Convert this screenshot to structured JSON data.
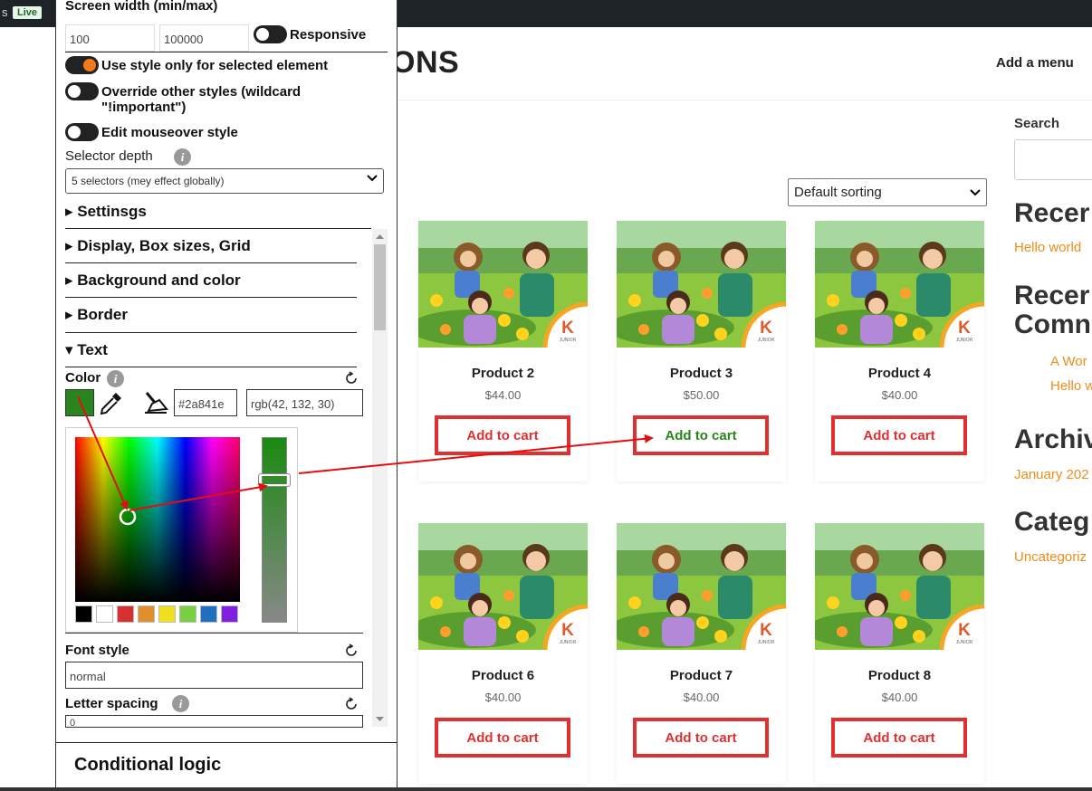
{
  "adminbar": {
    "prefix": "s",
    "live_badge": "Live"
  },
  "site": {
    "title_fragment": "ONS",
    "menu_link": "Add a menu"
  },
  "shop": {
    "sort_selected": "Default sorting",
    "products": [
      {
        "name": "Product 2",
        "price": "$44.00",
        "button": "Add to cart"
      },
      {
        "name": "Product 3",
        "price": "$50.00",
        "button": "Add to cart"
      },
      {
        "name": "Product 4",
        "price": "$40.00",
        "button": "Add to cart"
      },
      {
        "name": "Product 6",
        "price": "$40.00",
        "button": "Add to cart"
      },
      {
        "name": "Product 7",
        "price": "$40.00",
        "button": "Add to cart"
      },
      {
        "name": "Product 8",
        "price": "$40.00",
        "button": "Add to cart"
      }
    ],
    "badge_letter": "K",
    "badge_word": "JUNIOR"
  },
  "sidebar": {
    "search_label": "Search",
    "recent_posts_heading": "Recer",
    "recent_post_link": "Hello world",
    "recent_comments_heading_1": "Recer",
    "recent_comments_heading_2": "Comn",
    "comment_link_1": "A Wor",
    "comment_link_2": "Hello w",
    "archives_heading": "Archiv",
    "archive_link": "January 202",
    "categories_heading": "Categ",
    "category_link": "Uncategoriz"
  },
  "editor": {
    "screen_width_label": "Screen width (min/max)",
    "min_width": "100",
    "max_width": "100000",
    "responsive_label": "Responsive",
    "use_style_label": "Use style only for selected element",
    "override_label_1": "Override other styles (wildcard",
    "override_label_2": "\"!important\")",
    "mouseover_label": "Edit mouseover style",
    "selector_depth_label": "Selector depth",
    "selector_depth_value": "5 selectors (mey effect globally)",
    "sections": {
      "settings": "Settinsgs",
      "display": "Display, Box sizes, Grid",
      "background": "Background and color",
      "border": "Border",
      "text": "Text"
    },
    "color_label": "Color",
    "hex_value": "#2a841e",
    "rgb_value": "rgb(42, 132, 30)",
    "font_style_label": "Font style",
    "font_style_value": "normal",
    "letter_spacing_label": "Letter spacing",
    "letter_spacing_value": "0",
    "conditional_logic": "Conditional logic",
    "info_glyph": "i"
  },
  "colors": {
    "accent": "#e03030",
    "selected_color": "#2a841e",
    "link": "#f08c1a",
    "toggle_on": "#f37a1a",
    "swatches": [
      "#000000",
      "#ffffff",
      "#d63030",
      "#e0902a",
      "#f0e020",
      "#78d040",
      "#2070c0",
      "#8020e0"
    ]
  }
}
